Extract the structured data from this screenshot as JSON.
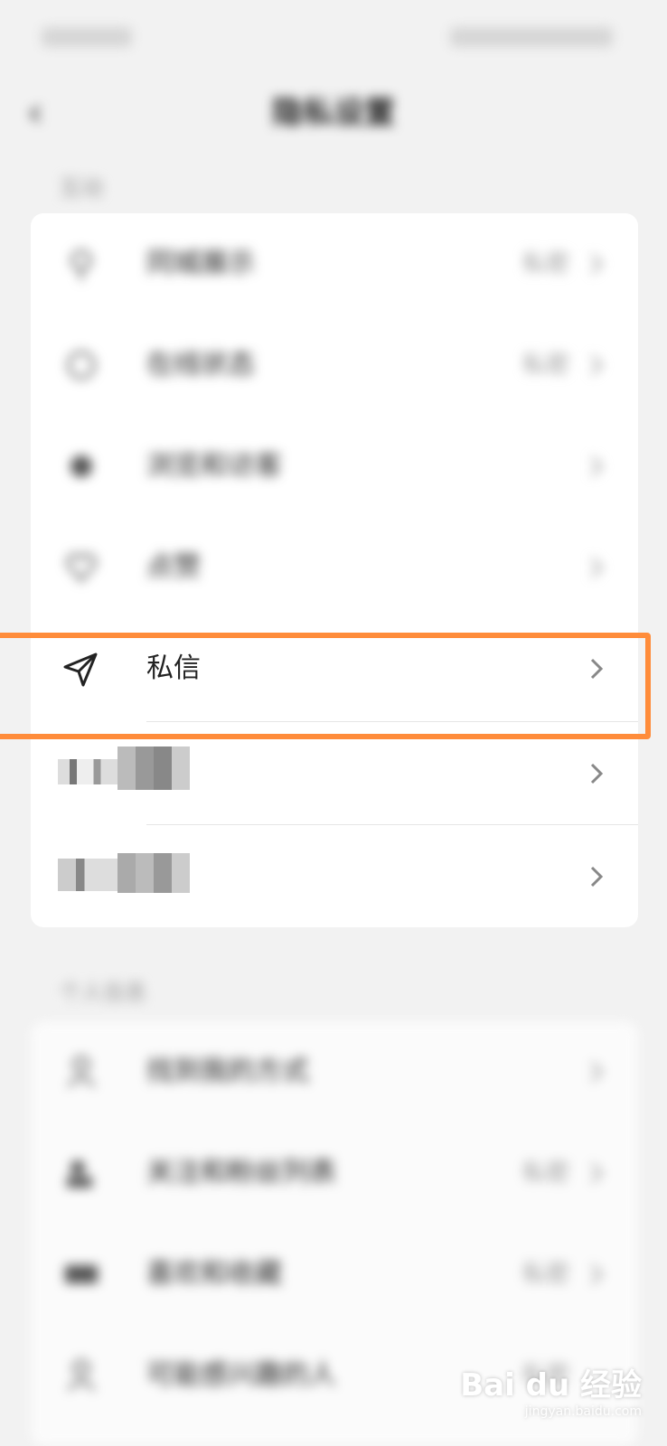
{
  "header": {
    "title": "隐私设置"
  },
  "section1": {
    "label": "互动"
  },
  "group1": [
    {
      "label": "同城展示",
      "value": "私密"
    },
    {
      "label": "在线状态",
      "value": "私密"
    },
    {
      "label": "浏览和访客",
      "value": ""
    },
    {
      "label": "点赞",
      "value": ""
    },
    {
      "label": "私信",
      "value": ""
    },
    {
      "label": "",
      "value": ""
    },
    {
      "label": "",
      "value": ""
    }
  ],
  "section2": {
    "label": "个人信息"
  },
  "group2": [
    {
      "label": "找到我的方式",
      "value": ""
    },
    {
      "label": "关注和粉丝列表",
      "value": "私密"
    },
    {
      "label": "喜欢和收藏",
      "value": "私密"
    },
    {
      "label": "可能感兴趣的人",
      "value": "私密"
    }
  ],
  "watermark": {
    "brand": "Bai du 经验",
    "url": "jingyan.baidu.com"
  },
  "colors": {
    "highlight": "#ff8c3a",
    "background": "#f2f2f2"
  }
}
